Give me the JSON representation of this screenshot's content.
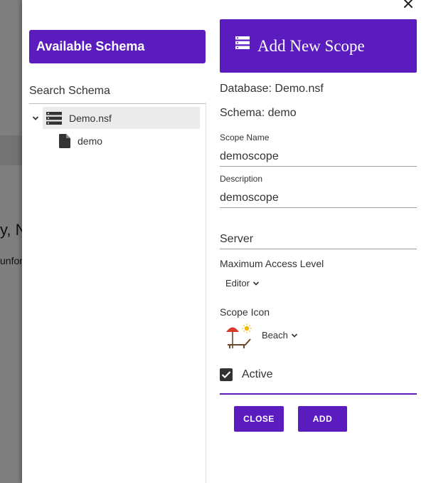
{
  "background": {
    "partial_heading": "y, N",
    "partial_text": "unfor"
  },
  "drawer": {
    "left": {
      "header_title": "Available Schema",
      "search_placeholder": "Search Schema",
      "tree": {
        "database": {
          "label": "Demo.nsf",
          "expanded": true
        },
        "schemas": [
          {
            "label": "demo"
          }
        ]
      }
    },
    "right": {
      "header_title": "Add New Scope",
      "database_line": "Database: Demo.nsf",
      "schema_line": "Schema: demo",
      "scope_name": {
        "label": "Scope Name",
        "value": "demoscope"
      },
      "description": {
        "label": "Description",
        "value": "demoscope"
      },
      "server": {
        "placeholder": "Server",
        "value": ""
      },
      "max_access": {
        "label": "Maximum Access Level",
        "selected": "Editor"
      },
      "scope_icon": {
        "label": "Scope Icon",
        "selected": "Beach"
      },
      "active": {
        "label": "Active",
        "checked": true
      },
      "buttons": {
        "close": "CLOSE",
        "add": "ADD"
      }
    }
  },
  "colors": {
    "accent": "#5b1cbf",
    "text": "#333333",
    "tree_selected_bg": "#ebebeb"
  }
}
